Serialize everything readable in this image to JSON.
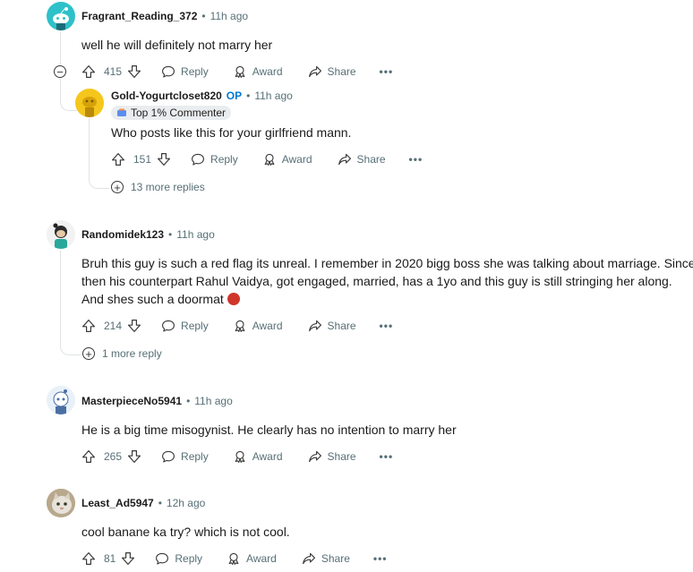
{
  "comments": [
    {
      "user": "Fragrant_Reading_372",
      "time": "11h ago",
      "text": "well he will definitely not marry her",
      "votes": "415",
      "actions": {
        "reply": "Reply",
        "award": "Award",
        "share": "Share"
      },
      "collapse": "−"
    },
    {
      "user": "Gold-Yogurtcloset820",
      "op": "OP",
      "time": "11h ago",
      "badge": "Top 1% Commenter",
      "text": "Who posts like this for your girlfriend mann.",
      "votes": "151",
      "actions": {
        "reply": "Reply",
        "award": "Award",
        "share": "Share"
      },
      "more_replies": "13 more replies"
    },
    {
      "user": "Randomidek123",
      "time": "11h ago",
      "text_lines": [
        "Bruh this guy is such a red flag its unreal. I remember in 2020 bigg boss she was talking about marriage. Since",
        "then his counterpart Rahul Vaidya, got engaged, married, has a 1yo and this guy is still stringing her along.",
        "And shes such a doormat"
      ],
      "emoji": "angry-face-emoji",
      "votes": "214",
      "actions": {
        "reply": "Reply",
        "award": "Award",
        "share": "Share"
      },
      "more_replies": "1 more reply"
    },
    {
      "user": "MasterpieceNo5941",
      "time": "11h ago",
      "text": "He is a big time misogynist. He clearly has no intention to marry her",
      "votes": "265",
      "actions": {
        "reply": "Reply",
        "award": "Award",
        "share": "Share"
      }
    },
    {
      "user": "Least_Ad5947",
      "time": "12h ago",
      "text": "cool banane ka try? which is not cool.",
      "votes": "81",
      "actions": {
        "reply": "Reply",
        "award": "Award",
        "share": "Share"
      }
    }
  ],
  "separator": "•",
  "overflow": "•••",
  "colors": {
    "op": "#0079d3",
    "meta": "#576f76",
    "thread_line": "#dfe3e5"
  }
}
